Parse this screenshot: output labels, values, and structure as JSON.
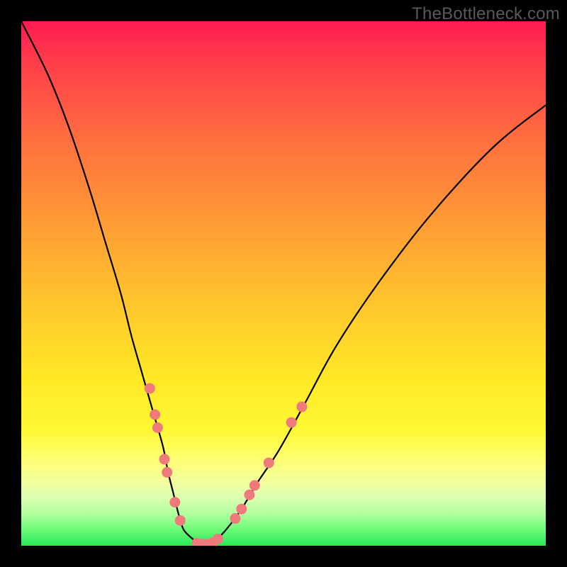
{
  "watermark": "TheBottleneck.com",
  "colors": {
    "gradient_top": "#ff1a52",
    "gradient_mid": "#ffe826",
    "gradient_bottom": "#27e95a",
    "curve": "#000000",
    "dots": "#ee7a7c",
    "frame": "#000000"
  },
  "chart_data": {
    "type": "line",
    "title": "",
    "xlabel": "",
    "ylabel": "",
    "xlim": [
      0,
      100
    ],
    "ylim": [
      0,
      100
    ],
    "grid": false,
    "legend": false,
    "series": [
      {
        "name": "bottleneck-curve",
        "x": [
          0,
          5,
          9,
          13,
          16,
          19,
          21,
          23,
          25,
          27,
          28,
          29,
          30,
          31,
          33,
          34,
          35.5,
          37,
          39,
          42,
          45,
          49,
          54,
          60,
          68,
          78,
          90,
          100
        ],
        "values": [
          100,
          90,
          80,
          68,
          58,
          48,
          40,
          33,
          26,
          19,
          14,
          10,
          6,
          3,
          1,
          0,
          0,
          1,
          3,
          7,
          12,
          18,
          27,
          38,
          50,
          63,
          76,
          84
        ]
      }
    ],
    "points": [
      {
        "x": 24.5,
        "y": 30.0
      },
      {
        "x": 25.5,
        "y": 25.0
      },
      {
        "x": 26.0,
        "y": 22.5
      },
      {
        "x": 27.3,
        "y": 16.5
      },
      {
        "x": 27.8,
        "y": 14.0
      },
      {
        "x": 29.3,
        "y": 8.3
      },
      {
        "x": 30.3,
        "y": 4.8
      },
      {
        "x": 33.5,
        "y": 0.5
      },
      {
        "x": 34.5,
        "y": 0.3
      },
      {
        "x": 35.5,
        "y": 0.3
      },
      {
        "x": 36.5,
        "y": 0.6
      },
      {
        "x": 37.5,
        "y": 1.3
      },
      {
        "x": 40.8,
        "y": 5.2
      },
      {
        "x": 42.0,
        "y": 7.0
      },
      {
        "x": 43.5,
        "y": 9.7
      },
      {
        "x": 44.5,
        "y": 11.5
      },
      {
        "x": 47.2,
        "y": 15.8
      },
      {
        "x": 51.5,
        "y": 23.5
      },
      {
        "x": 53.5,
        "y": 26.5
      }
    ]
  }
}
